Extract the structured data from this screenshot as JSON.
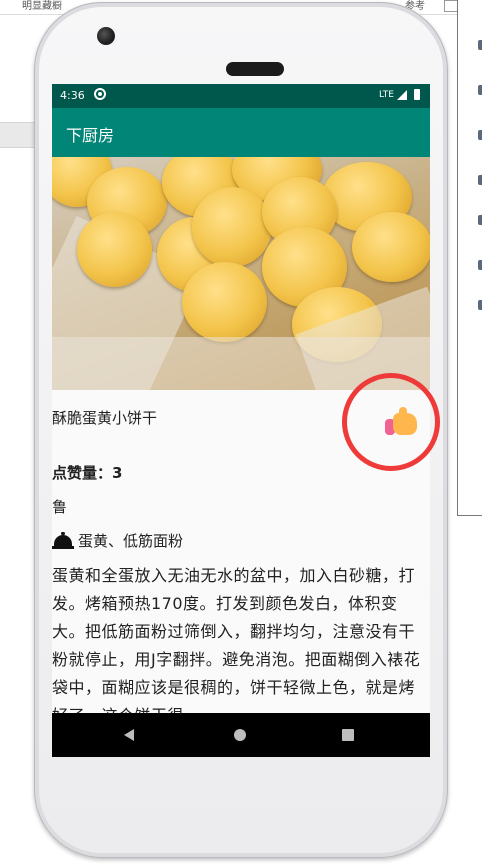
{
  "desktop": {
    "top_left_text": "明显藏橱",
    "top_right_text": "参考"
  },
  "status_bar": {
    "time": "4:36",
    "network": "LTE"
  },
  "app_bar": {
    "title": "下厨房"
  },
  "recipe": {
    "name": "酥脆蛋黄小饼干",
    "likes_label": "点赞量：",
    "likes_count": "3",
    "cuisine": "鲁",
    "ingredients": "蛋黄、低筋面粉",
    "description": "蛋黄和全蛋放入无油无水的盆中，加入白砂糖，打发。烤箱预热170度。打发到颜色发白，体积变大。把低筋面粉过筛倒入，翻拌均匀，注意没有干粉就停止，用J字翻拌。避免消泡。把面糊倒入裱花袋中，面糊应该是很稠的，饼干轻微上色，就是烤好了，这个饼干很"
  },
  "icons": {
    "like": "thumbs-up-icon",
    "ingredients": "cloche-icon",
    "nav_back": "back-icon",
    "nav_home": "home-icon",
    "nav_recent": "recent-apps-icon"
  },
  "colors": {
    "status_bar": "#00574b",
    "app_bar": "#008577",
    "annotation_circle": "#ef3a3a"
  }
}
